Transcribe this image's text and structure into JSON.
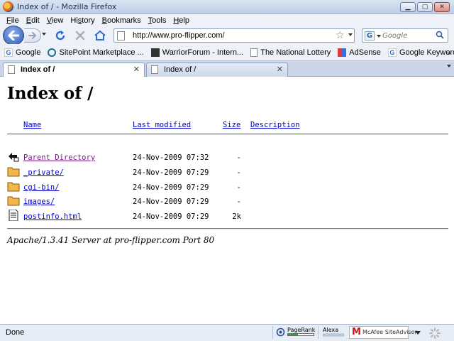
{
  "window": {
    "title": "Index of / - Mozilla Firefox",
    "buttons": [
      "minimize",
      "maximize",
      "close"
    ]
  },
  "menubar": {
    "items": [
      {
        "label": "File",
        "key": "F",
        "rest": "ile"
      },
      {
        "label": "Edit",
        "key": "E",
        "rest": "dit"
      },
      {
        "label": "View",
        "key": "V",
        "rest": "iew"
      },
      {
        "label": "History",
        "key": "",
        "pre": "Hi",
        "key2": "s",
        "rest": "tory"
      },
      {
        "label": "Bookmarks",
        "key": "B",
        "rest": "ookmarks"
      },
      {
        "label": "Tools",
        "key": "T",
        "rest": "ools"
      },
      {
        "label": "Help",
        "key": "H",
        "rest": "elp"
      }
    ]
  },
  "navbar": {
    "url": "http://www.pro-flipper.com/",
    "search_placeholder": "Google",
    "icons": [
      "back-icon",
      "forward-icon",
      "reload-icon",
      "stop-icon",
      "home-icon",
      "bookmark-star-icon",
      "search-icon"
    ]
  },
  "bookmarks": [
    {
      "label": "Google",
      "icon": "google-icon",
      "color": "#3366cc"
    },
    {
      "label": "SitePoint Marketplace ...",
      "icon": "sitepoint-icon",
      "color": "#1f6f8b"
    },
    {
      "label": "WarriorForum - Intern...",
      "icon": "warriorforum-icon",
      "color": "#333333"
    },
    {
      "label": "The National Lottery",
      "icon": "page-icon",
      "color": "#ffffff"
    },
    {
      "label": "AdSense",
      "icon": "adsense-icon",
      "color": "#d93a3a"
    },
    {
      "label": "Google Keyword Tool",
      "icon": "google-icon",
      "color": "#3366cc"
    }
  ],
  "tabs": [
    {
      "label": "Index of /",
      "active": true
    },
    {
      "label": "Index of /",
      "active": false
    }
  ],
  "page": {
    "heading": "Index of /",
    "columns": {
      "name": "Name",
      "modified": "Last modified",
      "size": "Size",
      "description": "Description"
    },
    "rows": [
      {
        "name": "Parent Directory",
        "modified": "24-Nov-2009 07:32",
        "size": "-",
        "icon": "back-folder-icon",
        "visited": true
      },
      {
        "name": "_private/",
        "modified": "24-Nov-2009 07:29",
        "size": "-",
        "icon": "folder-icon",
        "visited": false
      },
      {
        "name": "cgi-bin/",
        "modified": "24-Nov-2009 07:29",
        "size": "-",
        "icon": "folder-icon",
        "visited": false
      },
      {
        "name": "images/",
        "modified": "24-Nov-2009 07:29",
        "size": "-",
        "icon": "folder-icon",
        "visited": false
      },
      {
        "name": "postinfo.html",
        "modified": "24-Nov-2009 07:29",
        "size": "2k",
        "icon": "text-file-icon",
        "visited": false
      }
    ],
    "server_signature": "Apache/1.3.41 Server at pro-flipper.com Port 80"
  },
  "statusbar": {
    "text": "Done",
    "pagerank_label": "PageRank",
    "pagerank_fraction": 0.4,
    "alexa_label": "Alexa",
    "mcafee_label": "McAfee SiteAdvisor",
    "mcafee_mark": "M"
  }
}
